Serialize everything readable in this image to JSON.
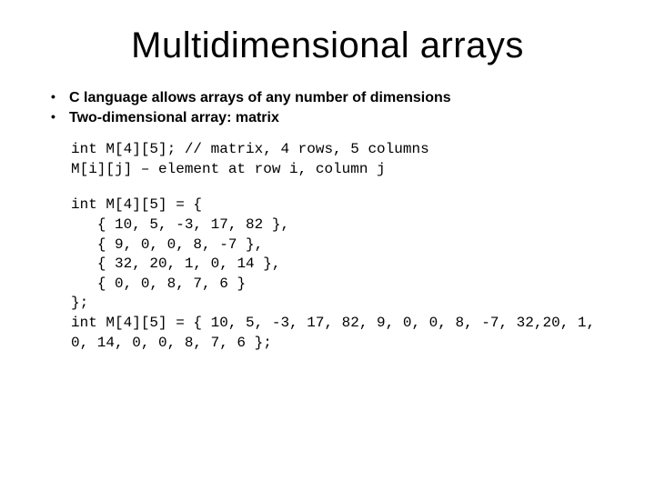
{
  "title": "Multidimensional arrays",
  "bullets": [
    "C language allows arrays of any number of dimensions",
    "Two-dimensional array: matrix"
  ],
  "code_block_1": "int M[4][5]; // matrix, 4 rows, 5 columns\nM[i][j] – element at row i, column j",
  "code_block_2": "int M[4][5] = {\n   { 10, 5, -3, 17, 82 },\n   { 9, 0, 0, 8, -7 },\n   { 32, 20, 1, 0, 14 },\n   { 0, 0, 8, 7, 6 }\n};\nint M[4][5] = { 10, 5, -3, 17, 82, 9, 0, 0, 8, -7, 32,20, 1, 0, 14, 0, 0, 8, 7, 6 };"
}
